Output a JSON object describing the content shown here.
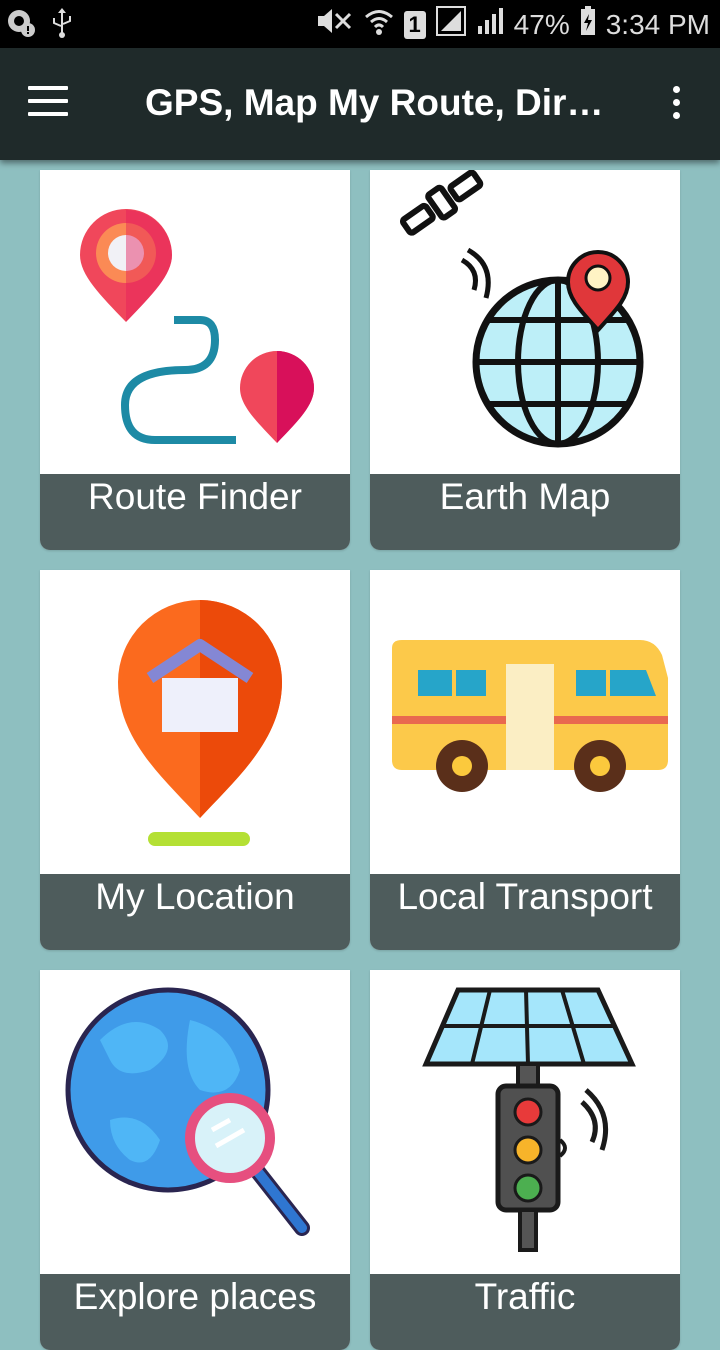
{
  "status_bar": {
    "battery": "47%",
    "time": "3:34 PM",
    "sim_slot": "1"
  },
  "app_bar": {
    "title": "GPS, Map My Route, Dire…"
  },
  "cards": [
    {
      "label": "Route Finder",
      "icon": "route-pins-icon"
    },
    {
      "label": "Earth Map",
      "icon": "satellite-globe-icon"
    },
    {
      "label": "My Location",
      "icon": "home-pin-icon"
    },
    {
      "label": "Local Transport",
      "icon": "bus-icon"
    },
    {
      "label": "Explore places",
      "icon": "globe-search-icon"
    },
    {
      "label": "Traffic",
      "icon": "traffic-light-icon"
    }
  ]
}
